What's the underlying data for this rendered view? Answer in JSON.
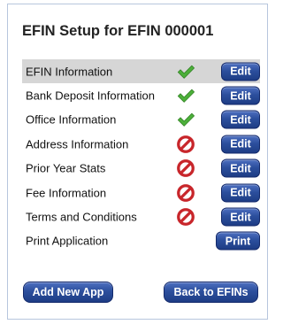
{
  "title": "EFIN Setup for EFIN 000001",
  "rows": [
    {
      "label": "EFIN Information",
      "status": "complete",
      "status_icon": "checkmark-icon",
      "action": "Edit",
      "selected": true
    },
    {
      "label": "Bank Deposit Information",
      "status": "complete",
      "status_icon": "checkmark-icon",
      "action": "Edit"
    },
    {
      "label": "Office Information",
      "status": "complete",
      "status_icon": "checkmark-icon",
      "action": "Edit"
    },
    {
      "label": "Address Information",
      "status": "incomplete",
      "status_icon": "prohibited-icon",
      "action": "Edit"
    },
    {
      "label": "Prior Year Stats",
      "status": "incomplete",
      "status_icon": "prohibited-icon",
      "action": "Edit"
    },
    {
      "label": "Fee Information",
      "status": "incomplete",
      "status_icon": "prohibited-icon",
      "action": "Edit"
    },
    {
      "label": "Terms and Conditions",
      "status": "incomplete",
      "status_icon": "prohibited-icon",
      "action": "Edit"
    },
    {
      "label": "Print Application",
      "status": "none",
      "status_icon": "",
      "action": "Print"
    }
  ],
  "footer": {
    "add_new_app": "Add New App",
    "back_to_efins": "Back to EFINs"
  },
  "colors": {
    "button": "#2c4f9d",
    "check": "#4caf3a",
    "prohibited": "#c8262b",
    "selected_row": "#d6d6d6",
    "panel_border": "#b7c6dd"
  }
}
